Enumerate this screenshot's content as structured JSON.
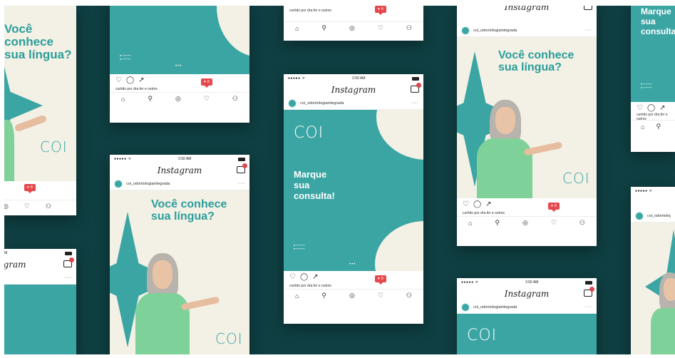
{
  "instagram": {
    "app_name": "Instagram",
    "status_time": "2:50 AM",
    "signal": "●●●●● ᯤ",
    "username": "coi_odontologiaintegrada",
    "liked_by": "curtido por dra.fer e outros",
    "likes_badge_count": "8"
  },
  "posts": {
    "question": "Você conhece sua língua?",
    "question_line1": "Você conhece",
    "question_line2": "sua língua?",
    "cta_line1": "Marque",
    "cta_line2": "sua",
    "cta_line3": "consulta!",
    "cta_partial": "consulta!",
    "brand_logo": "COI"
  },
  "colors": {
    "background": "#0f3f42",
    "teal": "#3aa5a3",
    "cream": "#f3f0e5",
    "badge": "#e5484d",
    "shirt": "#7fd19a"
  },
  "icons": [
    "home-icon",
    "search-icon",
    "camera-icon",
    "heart-icon",
    "profile-icon",
    "comment-icon",
    "share-icon",
    "inbox-icon"
  ]
}
